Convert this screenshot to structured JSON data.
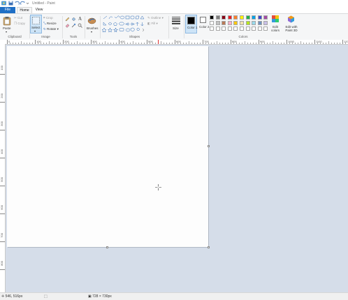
{
  "window": {
    "title": "Untitled - Paint"
  },
  "tabs": {
    "file": "File",
    "home": "Home",
    "view": "View"
  },
  "clipboard": {
    "paste": "Paste",
    "cut": "Cut",
    "copy": "Copy",
    "label": "Clipboard"
  },
  "image": {
    "select": "Select",
    "crop": "Crop",
    "resize": "Resize",
    "rotate": "Rotate",
    "label": "Image"
  },
  "tools": {
    "label": "Tools"
  },
  "brushes": {
    "label": "Brushes"
  },
  "shapes": {
    "outline": "Outline",
    "fill": "Fill",
    "label": "Shapes"
  },
  "size": {
    "label": "Size"
  },
  "colors": {
    "color1": "Color 1",
    "color2": "Color 2",
    "edit_colors": "Edit colors",
    "paint3d": "Edit with Paint 3D",
    "label": "Colors",
    "color1_value": "#000000",
    "color2_value": "#ffffff",
    "palette_row1": [
      "#000000",
      "#7f7f7f",
      "#880015",
      "#ed1c24",
      "#ff7f27",
      "#fff200",
      "#22b14c",
      "#00a2e8",
      "#3f48cc",
      "#a349a4"
    ],
    "palette_row2": [
      "#ffffff",
      "#c3c3c3",
      "#b97a57",
      "#ffaec9",
      "#ffc90e",
      "#efe4b0",
      "#b5e61d",
      "#99d9ea",
      "#7092be",
      "#c8bfe7"
    ]
  },
  "ruler": {
    "h_ticks": [
      "0",
      "100",
      "200",
      "300",
      "400",
      "500",
      "600",
      "700",
      "800",
      "900",
      "1000",
      "1100",
      "1200"
    ],
    "v_ticks": [
      "100",
      "200",
      "300",
      "400",
      "500",
      "600",
      "700",
      "800"
    ]
  },
  "status": {
    "cursor_position": "546, 516px",
    "canvas_size": "728 × 730px"
  }
}
